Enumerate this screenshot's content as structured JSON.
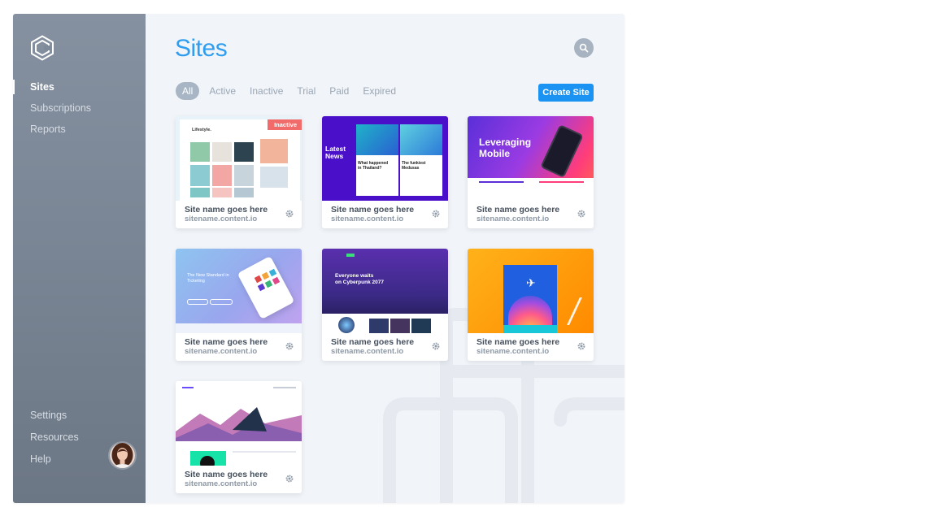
{
  "sidebar": {
    "logo_icon": "hexagon-c-logo",
    "nav": [
      {
        "label": "Sites",
        "active": true
      },
      {
        "label": "Subscriptions",
        "active": false
      },
      {
        "label": "Reports",
        "active": false
      }
    ],
    "bottom_nav": [
      {
        "label": "Settings"
      },
      {
        "label": "Resources"
      },
      {
        "label": "Help"
      }
    ]
  },
  "header": {
    "title": "Sites",
    "search_icon": "search-icon"
  },
  "filters": {
    "tabs": [
      "All",
      "Active",
      "Inactive",
      "Trial",
      "Paid",
      "Expired"
    ],
    "selected": "All"
  },
  "create_button": "Create Site",
  "sites": [
    {
      "name": "Site name goes here",
      "url": "sitename.content.io",
      "badge": "Inactive",
      "thumb": "lifestyle",
      "thumb_text": [
        "Lifestyle."
      ]
    },
    {
      "name": "Site name goes here",
      "url": "sitename.content.io",
      "thumb": "news",
      "thumb_text": [
        "Latest",
        "News",
        "What happened",
        "in Thailand?",
        "The funkiest",
        "Medusas"
      ]
    },
    {
      "name": "Site name goes here",
      "url": "sitename.content.io",
      "thumb": "mobile",
      "thumb_text": [
        "Leveraging",
        "Mobile"
      ]
    },
    {
      "name": "Site name goes here",
      "url": "sitename.content.io",
      "thumb": "ticketing",
      "thumb_text": [
        "The New Standard in",
        "Ticketing"
      ]
    },
    {
      "name": "Site name goes here",
      "url": "sitename.content.io",
      "thumb": "cyberpunk",
      "thumb_text": [
        "Everyone waits",
        "on Cyberpunk 2077"
      ]
    },
    {
      "name": "Site name goes here",
      "url": "sitename.content.io",
      "thumb": "travel",
      "thumb_text": []
    },
    {
      "name": "Site name goes here",
      "url": "sitename.content.io",
      "thumb": "landscape",
      "thumb_text": []
    }
  ],
  "colors": {
    "accent": "#2f9df0",
    "button": "#1b93f2",
    "badge": "#f26b6b",
    "sidebar": "#7a8695",
    "main_bg": "#f1f4f8"
  }
}
